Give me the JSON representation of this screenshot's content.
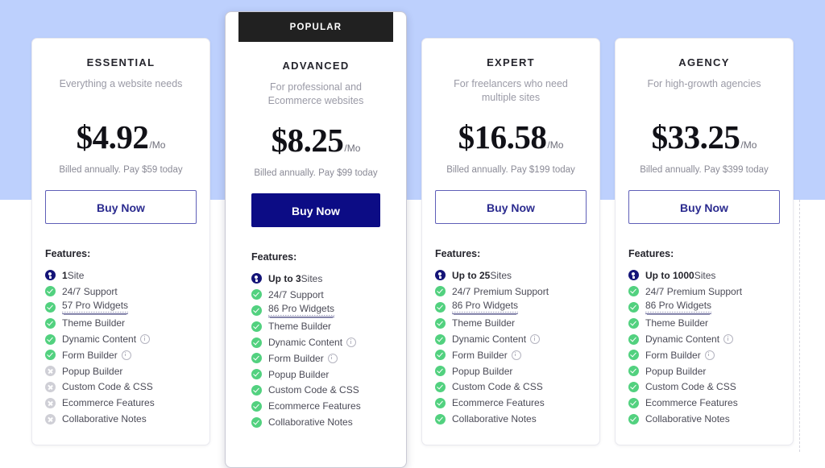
{
  "theme": {
    "band_color": "#bdd0fd",
    "accent_navy": "#0c0c85",
    "outline_blue": "#2b2b8f",
    "check_green": "#52d17f",
    "disabled_gray": "#cfcfd6",
    "banner_black": "#212121"
  },
  "featured_banner": {
    "label": "POPULAR"
  },
  "plans": [
    {
      "name": "ESSENTIAL",
      "tagline": "Everything a website needs",
      "price": "$4.92",
      "period": "/Mo",
      "billing_note": "Billed annually. Pay $59 today",
      "cta": "Buy Now",
      "features_title": "Features:",
      "featured": false,
      "features": [
        {
          "icon": "sites-icon",
          "strong": "1",
          "text": " Site"
        },
        {
          "icon": "check-icon",
          "text": "24/7 Support"
        },
        {
          "icon": "check-icon",
          "text": "57 Pro Widgets",
          "link": true
        },
        {
          "icon": "check-icon",
          "text": "Theme Builder"
        },
        {
          "icon": "check-icon",
          "text": "Dynamic Content",
          "info": true
        },
        {
          "icon": "check-icon",
          "text": "Form Builder",
          "info": true
        },
        {
          "icon": "cross-icon",
          "text": "Popup Builder"
        },
        {
          "icon": "cross-icon",
          "text": "Custom Code & CSS"
        },
        {
          "icon": "cross-icon",
          "text": "Ecommerce Features"
        },
        {
          "icon": "cross-icon",
          "text": "Collaborative Notes"
        }
      ]
    },
    {
      "name": "ADVANCED",
      "tagline": "For professional and Ecommerce websites",
      "price": "$8.25",
      "period": "/Mo",
      "billing_note": "Billed annually. Pay $99 today",
      "cta": "Buy Now",
      "features_title": "Features:",
      "featured": true,
      "features": [
        {
          "icon": "sites-icon",
          "strong": "Up to 3",
          "text": " Sites"
        },
        {
          "icon": "check-icon",
          "text": "24/7 Support"
        },
        {
          "icon": "check-icon",
          "text": "86 Pro Widgets",
          "link": true
        },
        {
          "icon": "check-icon",
          "text": "Theme Builder"
        },
        {
          "icon": "check-icon",
          "text": "Dynamic Content",
          "info": true
        },
        {
          "icon": "check-icon",
          "text": "Form Builder",
          "info": true
        },
        {
          "icon": "check-icon",
          "text": "Popup Builder"
        },
        {
          "icon": "check-icon",
          "text": "Custom Code & CSS"
        },
        {
          "icon": "check-icon",
          "text": "Ecommerce Features"
        },
        {
          "icon": "check-icon",
          "text": "Collaborative Notes"
        }
      ]
    },
    {
      "name": "EXPERT",
      "tagline": "For freelancers who need multiple sites",
      "price": "$16.58",
      "period": "/Mo",
      "billing_note": "Billed annually. Pay $199 today",
      "cta": "Buy Now",
      "features_title": "Features:",
      "featured": false,
      "features": [
        {
          "icon": "sites-icon",
          "strong": "Up to 25",
          "text": " Sites"
        },
        {
          "icon": "check-icon",
          "text": "24/7 Premium Support"
        },
        {
          "icon": "check-icon",
          "text": "86 Pro Widgets",
          "link": true
        },
        {
          "icon": "check-icon",
          "text": "Theme Builder"
        },
        {
          "icon": "check-icon",
          "text": "Dynamic Content",
          "info": true
        },
        {
          "icon": "check-icon",
          "text": "Form Builder",
          "info": true
        },
        {
          "icon": "check-icon",
          "text": "Popup Builder"
        },
        {
          "icon": "check-icon",
          "text": "Custom Code & CSS"
        },
        {
          "icon": "check-icon",
          "text": "Ecommerce Features"
        },
        {
          "icon": "check-icon",
          "text": "Collaborative Notes"
        }
      ]
    },
    {
      "name": "AGENCY",
      "tagline": "For high-growth agencies",
      "price": "$33.25",
      "period": "/Mo",
      "billing_note": "Billed annually. Pay $399 today",
      "cta": "Buy Now",
      "features_title": "Features:",
      "featured": false,
      "features": [
        {
          "icon": "sites-icon",
          "strong": "Up to 1000",
          "text": " Sites"
        },
        {
          "icon": "check-icon",
          "text": "24/7 Premium Support"
        },
        {
          "icon": "check-icon",
          "text": "86 Pro Widgets",
          "link": true
        },
        {
          "icon": "check-icon",
          "text": "Theme Builder"
        },
        {
          "icon": "check-icon",
          "text": "Dynamic Content",
          "info": true
        },
        {
          "icon": "check-icon",
          "text": "Form Builder",
          "info": true
        },
        {
          "icon": "check-icon",
          "text": "Popup Builder"
        },
        {
          "icon": "check-icon",
          "text": "Custom Code & CSS"
        },
        {
          "icon": "check-icon",
          "text": "Ecommerce Features"
        },
        {
          "icon": "check-icon",
          "text": "Collaborative Notes"
        }
      ]
    }
  ]
}
